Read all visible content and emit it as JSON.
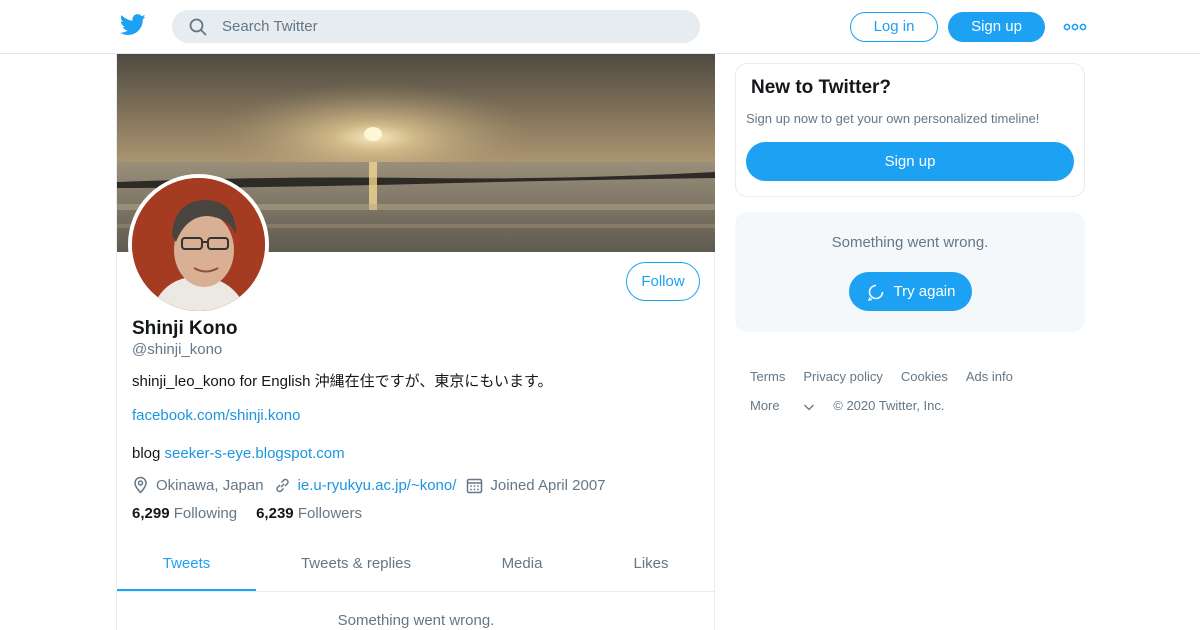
{
  "header": {
    "logo_icon": "twitter-bird-icon",
    "search": {
      "placeholder": "Search Twitter",
      "value": ""
    },
    "login_label": "Log in",
    "signup_label": "Sign up",
    "more_icon": "more-dots-icon"
  },
  "profile": {
    "name": "Shinji Kono",
    "handle": "@shinji_kono",
    "follow_label": "Follow",
    "bio_line1": "shinji_leo_kono for English 沖縄在住ですが、東京にもいます。",
    "bio_link": "facebook.com/shinji.kono",
    "bio_line3_prefix": "blog ",
    "bio_line3_link": "seeker-s-eye.blogspot.com",
    "location": "Okinawa, Japan",
    "website": "ie.u-ryukyu.ac.jp/~kono/",
    "joined": "Joined April 2007",
    "following_count": "6,299",
    "following_label": "Following",
    "followers_count": "6,239",
    "followers_label": "Followers"
  },
  "tabs": [
    {
      "label": "Tweets",
      "active": true
    },
    {
      "label": "Tweets & replies",
      "active": false
    },
    {
      "label": "Media",
      "active": false
    },
    {
      "label": "Likes",
      "active": false
    }
  ],
  "timeline_error": "Something went wrong.",
  "sidebar": {
    "new_title": "New to Twitter?",
    "new_text": "Sign up now to get your own personalized timeline!",
    "signup_label": "Sign up",
    "error_text": "Something went wrong.",
    "retry_label": "Try again"
  },
  "footer": {
    "links": [
      "Terms",
      "Privacy policy",
      "Cookies",
      "Ads info"
    ],
    "more_label": "More",
    "copyright": "© 2020 Twitter, Inc."
  },
  "colors": {
    "accent": "#1da1f2",
    "link": "#1b95e0",
    "muted": "#657786"
  }
}
